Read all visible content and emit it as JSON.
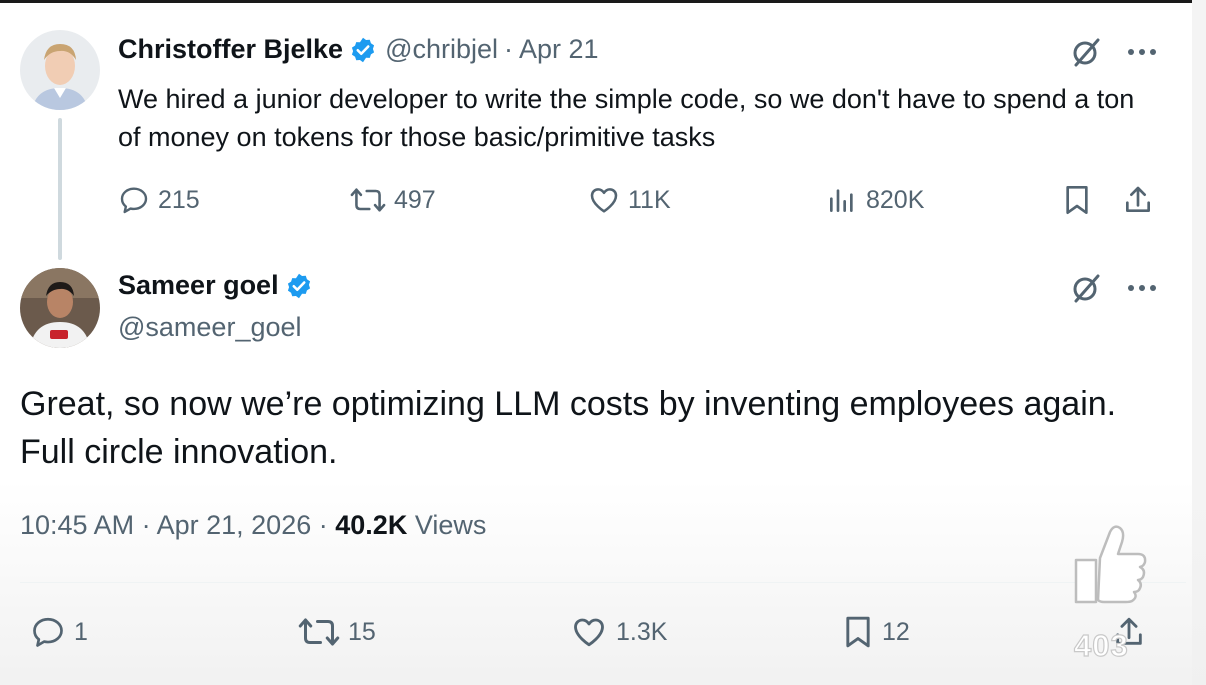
{
  "tweet1": {
    "author_name": "Christoffer Bjelke",
    "handle": "@chribjel",
    "separator": "·",
    "date": "Apr 21",
    "text": "We hired a junior developer to write the simple code, so we don't have to spend a ton of money on tokens for those basic/primitive tasks",
    "stats": {
      "replies": "215",
      "reposts": "497",
      "likes": "11K",
      "views": "820K"
    }
  },
  "tweet2": {
    "author_name": "Sameer goel",
    "handle": "@sameer_goel",
    "text_line1": "Great, so now we’re optimizing LLM costs by inventing employees again.",
    "text_line2": "Full circle innovation.",
    "time": "10:45 AM",
    "separator": "·",
    "date": "Apr 21, 2026",
    "views_count": "40.2K",
    "views_label": "Views",
    "stats": {
      "replies": "1",
      "reposts": "15",
      "likes": "1.3K",
      "bookmarks": "12"
    }
  },
  "overlay": {
    "like_count": "403",
    "icon": "thumbs-up-icon"
  },
  "colors": {
    "text": "#0f1419",
    "secondary": "#536471",
    "verified": "#1d9bf0",
    "thread_line": "#cfd9de"
  }
}
